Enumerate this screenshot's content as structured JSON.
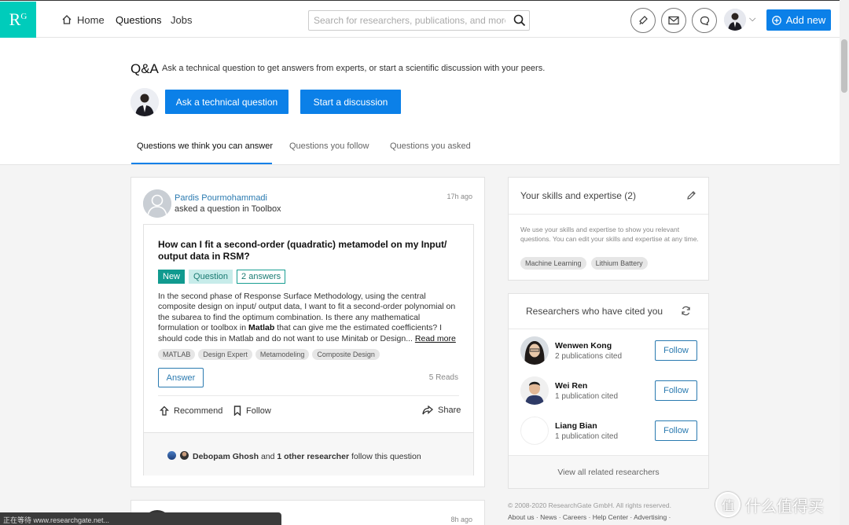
{
  "nav": {
    "home_label": "Home",
    "questions_label": "Questions",
    "jobs_label": "Jobs",
    "search_placeholder": "Search for researchers, publications, and more",
    "add_new_label": "Add new",
    "brand_color": "#0b80e8",
    "logo_color": "#00ccbb"
  },
  "hero": {
    "title": "Q&A",
    "description": "Ask a technical question to get answers from experts, or start a scientific discussion with your peers.",
    "ask_button": "Ask a technical question",
    "discuss_button": "Start a discussion",
    "tabs": [
      {
        "label": "Questions we think you can answer",
        "active": true
      },
      {
        "label": "Questions you follow",
        "active": false
      },
      {
        "label": "Questions you asked",
        "active": false
      }
    ]
  },
  "question": {
    "author": "Pardis Pourmohammadi",
    "action": "asked a question in Toolbox",
    "time": "17h ago",
    "title": "How can I fit a second-order (quadratic) metamodel on my Input/ output data in RSM?",
    "tag_new": "New",
    "tag_type": "Question",
    "answers": "2 answers",
    "body_part1": "In the second phase of Response Surface Methodology, using the central composite design on input/ output data, I want to fit a second-order polynomial on the subarea to find the optimum combination. Is there any mathematical formulation or toolbox in ",
    "body_bold": "Matlab",
    "body_part2": " that can give me the estimated coefficients? I should code this in Matlab and do not want to use Minitab or Design",
    "ellipsis": "...",
    "read_more": "Read more",
    "keywords": [
      "MATLAB",
      "Design Expert",
      "Metamodeling",
      "Composite Design"
    ],
    "answer_button": "Answer",
    "reads": "5 Reads",
    "recommend_label": "Recommend",
    "follow_label": "Follow",
    "share_label": "Share",
    "followers_name": "Debopam Ghosh",
    "followers_and": "and",
    "followers_other": "1 other researcher",
    "followers_suffix": "follow this question"
  },
  "question2": {
    "time": "8h ago"
  },
  "skills": {
    "title": "Your skills and expertise (2)",
    "description": "We use your skills and expertise to show you relevant questions. You can edit your skills and expertise at any time.",
    "tags": [
      "Machine Learning",
      "Lithium Battery"
    ]
  },
  "researchers": {
    "title": "Researchers who have cited you",
    "items": [
      {
        "name": "Wenwen Kong",
        "sub": "2 publications cited",
        "button": "Follow"
      },
      {
        "name": "Wei Ren",
        "sub": "1 publication cited",
        "button": "Follow"
      },
      {
        "name": "Liang Bian",
        "sub": "1 publication cited",
        "button": "Follow"
      }
    ],
    "view_all": "View all related researchers"
  },
  "footer": {
    "copyright": "© 2008-2020 ResearchGate GmbH. All rights reserved.",
    "links": "About us · News · Careers · Help Center · Advertising ·"
  },
  "statusbar": {
    "text": "正在等待 www.researchgate.net..."
  },
  "watermark": {
    "text": "什么值得买",
    "glyph": "值"
  }
}
